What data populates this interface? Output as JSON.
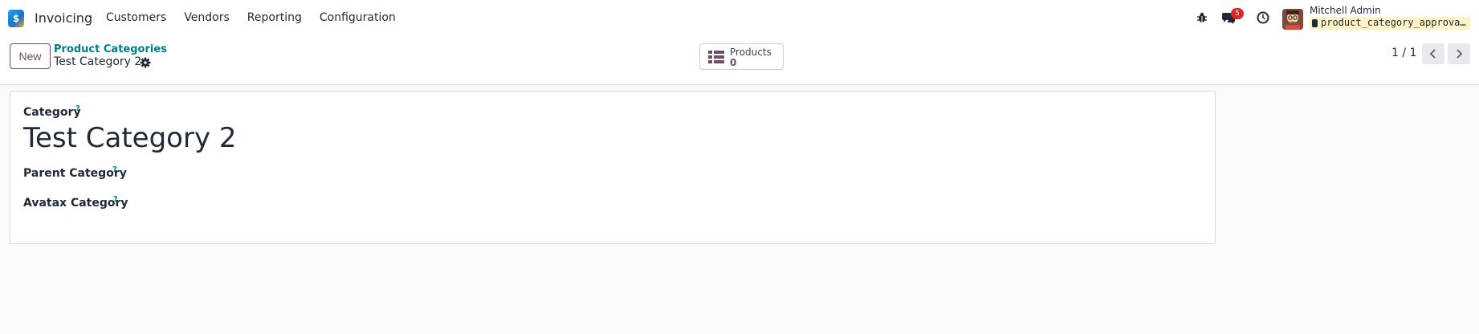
{
  "navbar": {
    "logo_letter": "$",
    "app_name": "Invoicing",
    "menu": [
      "Customers",
      "Vendors",
      "Reporting",
      "Configuration"
    ],
    "notification_count": "5",
    "user_name": "Mitchell Admin",
    "database": "product_category_approva…",
    "icons": [
      "bug-icon",
      "chat-icon",
      "clock-icon"
    ]
  },
  "control_panel": {
    "new_label": "New",
    "breadcrumb_parent": "Product Categories",
    "record_title": "Test Category 2",
    "smart_button": {
      "label": "Products",
      "count": "0"
    },
    "pager": "1 / 1"
  },
  "form": {
    "category_label": "Category",
    "category_value": "Test Category 2",
    "parent_label": "Parent Category",
    "avatax_label": "Avatax Category",
    "help_mark": "?"
  },
  "colors": {
    "primary": "#714b67",
    "link": "#017e84",
    "badge": "#dc2626",
    "db_highlight": "#fef3c7"
  }
}
